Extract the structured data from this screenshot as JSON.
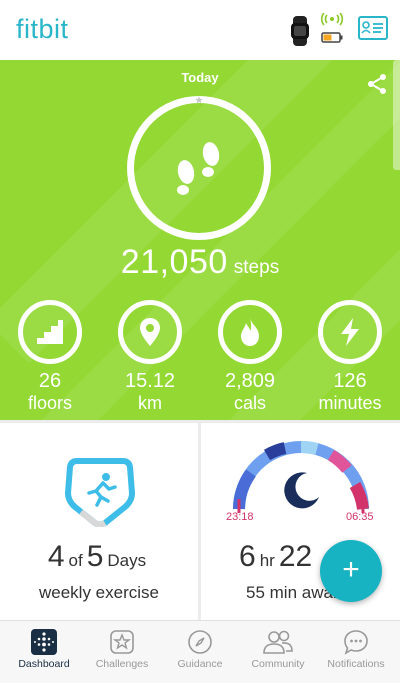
{
  "app": {
    "brand": "fitbit"
  },
  "hero": {
    "period": "Today",
    "steps": {
      "value": "21,050",
      "unit": "steps"
    },
    "stats": [
      {
        "value": "26",
        "unit": "floors",
        "icon": "stairs-icon"
      },
      {
        "value": "15.12",
        "unit": "km",
        "icon": "location-pin-icon"
      },
      {
        "value": "2,809",
        "unit": "cals",
        "icon": "flame-icon"
      },
      {
        "value": "126",
        "unit": "minutes",
        "icon": "lightning-icon"
      }
    ]
  },
  "exercise": {
    "count": "4",
    "of": "of",
    "goal": "5",
    "period": "Days",
    "label": "weekly exercise"
  },
  "sleep": {
    "start": "23:18",
    "end": "06:35",
    "hours": "6",
    "hours_unit": "hr",
    "minutes": "22",
    "sub": "55 min awake"
  },
  "fab": {
    "label": "+"
  },
  "nav": {
    "items": [
      {
        "label": "Dashboard",
        "icon": "dashboard-icon",
        "active": true
      },
      {
        "label": "Challenges",
        "icon": "star-badge-icon",
        "active": false
      },
      {
        "label": "Guidance",
        "icon": "compass-icon",
        "active": false
      },
      {
        "label": "Community",
        "icon": "people-icon",
        "active": false
      },
      {
        "label": "Notifications",
        "icon": "chat-bubble-icon",
        "active": false
      }
    ]
  },
  "colors": {
    "brand": "#29b6c9",
    "hero_green": "#93d833",
    "fab": "#17b3c2",
    "sleep_time": "#d2336b",
    "moon": "#1a2e5c"
  }
}
